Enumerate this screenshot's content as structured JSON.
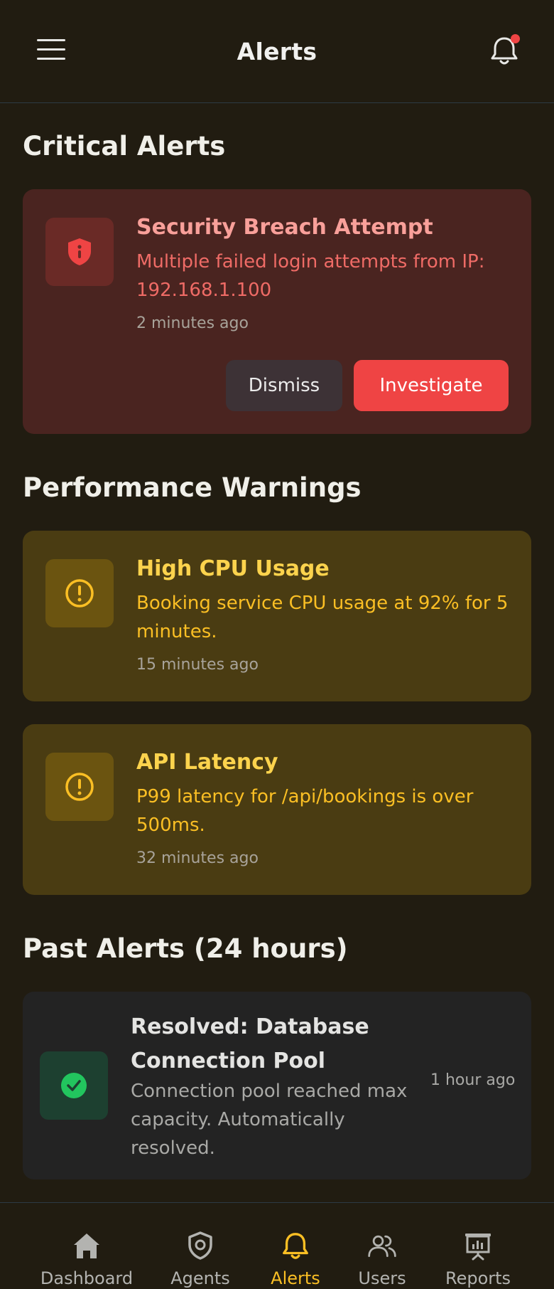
{
  "header": {
    "title": "Alerts",
    "menu_icon": "hamburger-menu-icon",
    "bell_icon": "bell-icon",
    "has_unread": true
  },
  "sections": {
    "critical_title": "Critical Alerts",
    "performance_title": "Performance Warnings",
    "past_title": "Past Alerts (24 hours)"
  },
  "critical_alert": {
    "icon": "shield-alert-icon",
    "title": "Security Breach Attempt",
    "description": "Multiple failed login attempts from IP: 192.168.1.100",
    "time": "2 minutes ago",
    "dismiss_label": "Dismiss",
    "investigate_label": "Investigate"
  },
  "warnings": [
    {
      "icon": "exclamation-circle-icon",
      "title": "High CPU Usage",
      "description": "Booking service CPU usage at 92% for 5 minutes.",
      "time": "15 minutes ago"
    },
    {
      "icon": "exclamation-circle-icon",
      "title": "API Latency",
      "description": "P99 latency for /api/bookings is over 500ms.",
      "time": "32 minutes ago"
    }
  ],
  "past_alert": {
    "icon": "check-circle-icon",
    "title": "Resolved: Database Connection Pool",
    "description": "Connection pool reached max capacity. Automatically resolved.",
    "time": "1 hour ago"
  },
  "nav": [
    {
      "label": "Dashboard",
      "icon": "home-icon",
      "active": false
    },
    {
      "label": "Agents",
      "icon": "shield-icon",
      "active": false
    },
    {
      "label": "Alerts",
      "icon": "bell-icon",
      "active": true
    },
    {
      "label": "Users",
      "icon": "users-icon",
      "active": false
    },
    {
      "label": "Reports",
      "icon": "presentation-chart-icon",
      "active": false
    }
  ],
  "colors": {
    "background": "#211c11",
    "critical_card": "#4a2420",
    "warning_card": "#4a3c12",
    "past_card": "#232323",
    "danger": "#ef4444",
    "warning_accent": "#fbbf24",
    "success": "#22c55e"
  }
}
